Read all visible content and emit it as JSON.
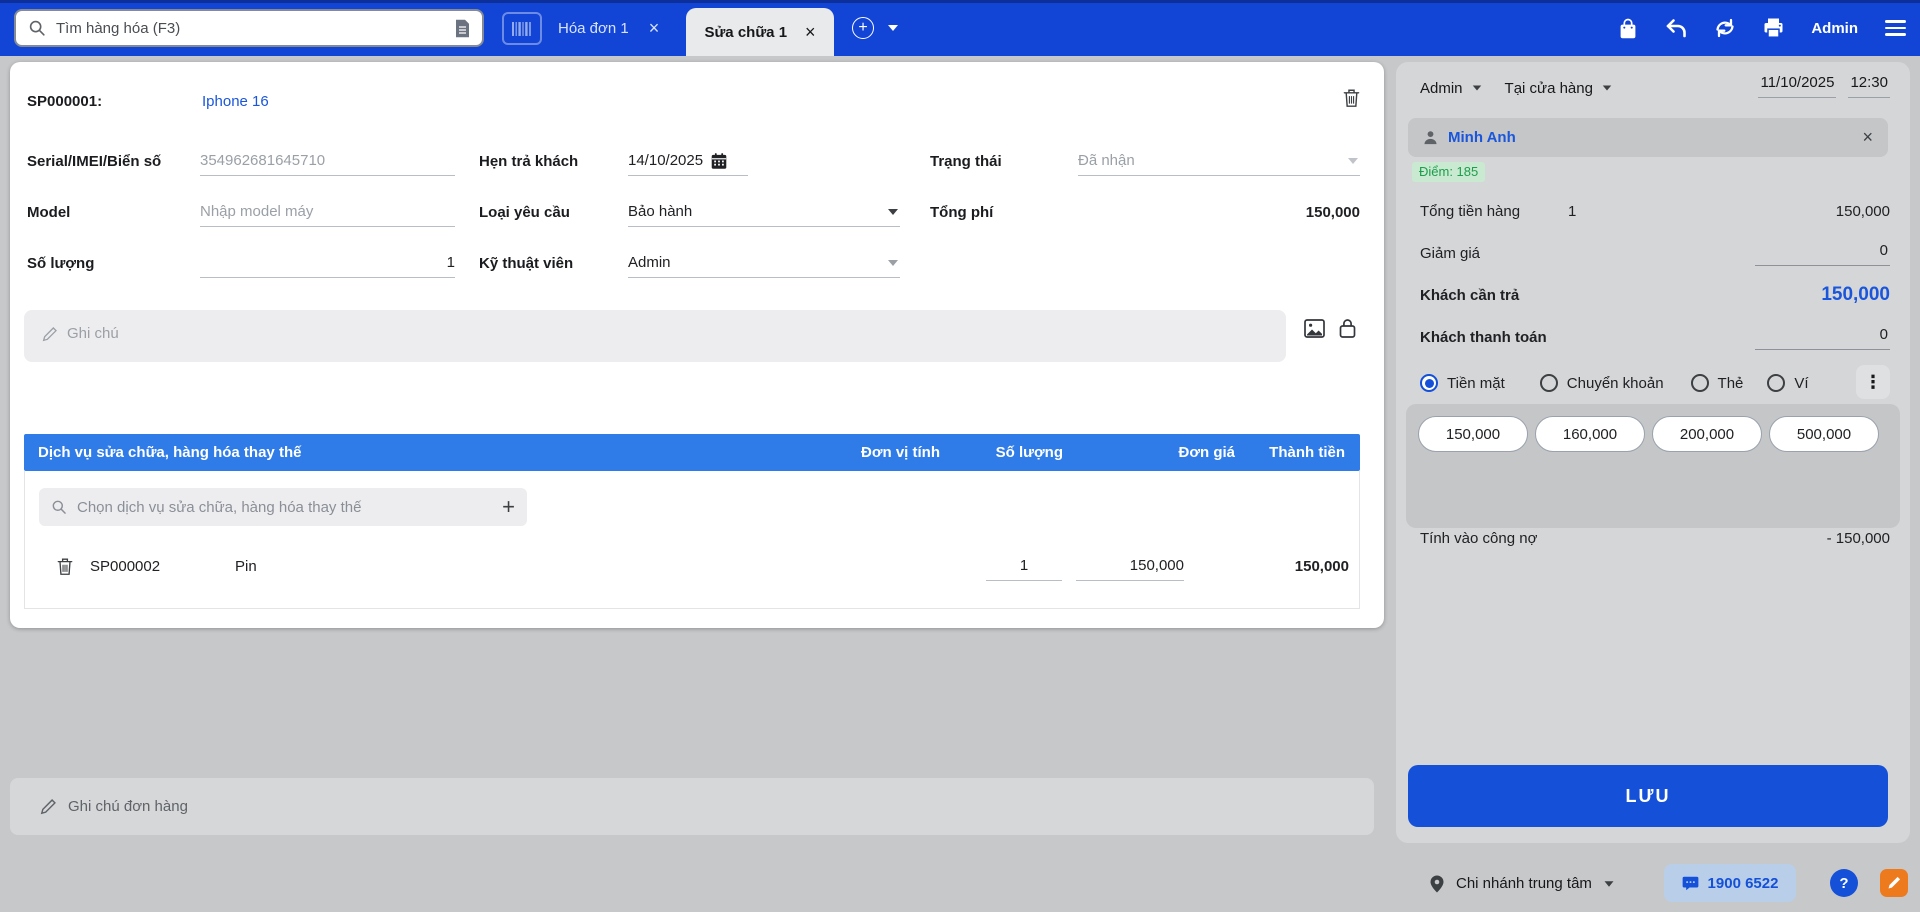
{
  "topbar": {
    "search_placeholder": "Tìm hàng hóa (F3)",
    "tabs": [
      {
        "label": "Hóa đơn 1"
      },
      {
        "label": "Sửa chữa 1"
      }
    ],
    "user_label": "Admin"
  },
  "repair": {
    "code": "SP000001:",
    "product": "Iphone 16",
    "serial_label": "Serial/IMEI/Biển số",
    "serial_value": "354962681645710",
    "return_label": "Hẹn trả khách",
    "return_value": "14/10/2025",
    "status_label": "Trạng thái",
    "status_value": "Đã nhận",
    "model_label": "Model",
    "model_placeholder": "Nhập model máy",
    "type_label": "Loại yêu cầu",
    "type_value": "Bảo hành",
    "fee_label": "Tổng phí",
    "fee_value": "150,000",
    "qty_label": "Số lượng",
    "qty_value": "1",
    "tech_label": "Kỹ thuật viên",
    "tech_value": "Admin",
    "note_placeholder": "Ghi chú"
  },
  "table": {
    "title": "Dịch vụ sửa chữa, hàng hóa thay thế",
    "col_unit": "Đơn vị tính",
    "col_qty": "Số lượng",
    "col_price": "Đơn giá",
    "col_amount": "Thành tiền",
    "search_placeholder": "Chọn dịch vụ sửa chữa, hàng hóa thay thế",
    "row": {
      "code": "SP000002",
      "name": "Pin",
      "qty": "1",
      "price": "150,000",
      "amount": "150,000"
    }
  },
  "order_note_placeholder": "Ghi chú đơn hàng",
  "panel": {
    "seller": "Admin",
    "channel": "Tại cửa hàng",
    "date": "11/10/2025",
    "time": "12:30",
    "customer": "Minh Anh",
    "points": "Điểm: 185",
    "total_label": "Tổng tiền hàng",
    "total_qty": "1",
    "total_value": "150,000",
    "discount_label": "Giảm giá",
    "discount_value": "0",
    "due_label": "Khách cần trả",
    "due_value": "150,000",
    "paid_label": "Khách thanh toán",
    "paid_value": "0",
    "payments": [
      "Tiền mặt",
      "Chuyển khoản",
      "Thẻ",
      "Ví"
    ],
    "selected_payment": "Tiền mặt",
    "quick_amounts": [
      "150,000",
      "160,000",
      "200,000",
      "500,000"
    ],
    "debt_label": "Tính vào công nợ",
    "debt_value": "- 150,000",
    "save_label": "LƯU"
  },
  "footer": {
    "branch": "Chi nhánh trung tâm",
    "hotline": "1900 6522"
  },
  "glyphs": {
    "close": "×",
    "plus": "+",
    "dots": "⋮",
    "question": "?"
  },
  "colors": {
    "topbar": "#1245d6",
    "accent": "#1a56db",
    "table_header": "#2f7ce8",
    "save_button": "#1450d8",
    "points_green": "#1d9e4b",
    "hotline_pill": "#b9cfe9",
    "feedback_orange": "#ee7a1e"
  }
}
